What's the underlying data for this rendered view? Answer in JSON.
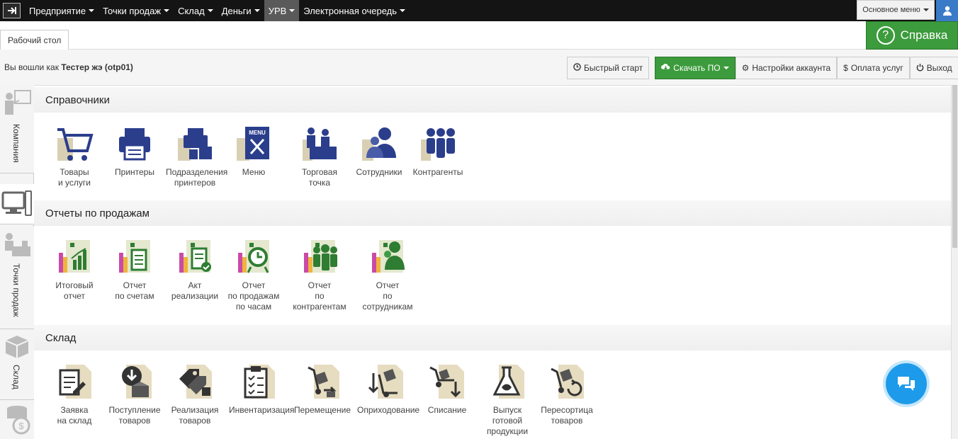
{
  "topbar": {
    "items": [
      {
        "label": "Предприятие"
      },
      {
        "label": "Точки продаж"
      },
      {
        "label": "Склад"
      },
      {
        "label": "Деньги"
      },
      {
        "label": "УРВ"
      },
      {
        "label": "Электронная очередь"
      }
    ],
    "active_item": "УРВ",
    "main_menu_label": "Основное меню"
  },
  "tabs": [
    {
      "label": "Рабочий стол"
    }
  ],
  "help_label": "Справка",
  "login": {
    "prefix": "Вы вошли как",
    "user": "Тестер жэ (otp01)"
  },
  "toolbar": {
    "quick_start": "Быстрый старт",
    "download": "Скачать ПО",
    "account_settings": "Настройки аккаунта",
    "payment": "Оплата услуг",
    "logout": "Выход"
  },
  "sidebar": {
    "items": [
      {
        "label": "Компания"
      },
      {
        "label": "Точки продаж"
      },
      {
        "label": "Склад"
      }
    ]
  },
  "sections": [
    {
      "title": "Справочники",
      "tiles": [
        {
          "label": "Товары\nи услуги",
          "icon": "cart-icon"
        },
        {
          "label": "Принтеры",
          "icon": "printer-icon"
        },
        {
          "label": "Подразделения\nпринтеров",
          "icon": "printer-department-icon"
        },
        {
          "label": "Меню",
          "icon": "menu-icon"
        },
        {
          "label": "Торговая\nточка",
          "icon": "store-icon"
        },
        {
          "label": "Сотрудники",
          "icon": "employees-icon"
        },
        {
          "label": "Контрагенты",
          "icon": "contractors-icon"
        }
      ]
    },
    {
      "title": "Отчеты по продажам",
      "tiles": [
        {
          "label": "Итоговый\nотчет",
          "icon": "summary-report-icon"
        },
        {
          "label": "Отчет\nпо счетам",
          "icon": "bills-report-icon"
        },
        {
          "label": "Акт\nреализации",
          "icon": "sales-act-icon"
        },
        {
          "label": "Отчет\nпо продажам\nпо часам",
          "icon": "hourly-report-icon"
        },
        {
          "label": "Отчет\nпо контрагентам",
          "icon": "contractors-report-icon"
        },
        {
          "label": "Отчет\nпо сотрудникам",
          "icon": "employees-report-icon"
        }
      ]
    },
    {
      "title": "Склад",
      "tiles": [
        {
          "label": "Заявка\nна склад",
          "icon": "warehouse-request-icon"
        },
        {
          "label": "Поступление\nтоваров",
          "icon": "goods-receipt-icon"
        },
        {
          "label": "Реализация\nтоваров",
          "icon": "goods-sale-icon"
        },
        {
          "label": "Инвентаризация",
          "icon": "inventory-icon"
        },
        {
          "label": "Перемещение",
          "icon": "transfer-icon"
        },
        {
          "label": "Оприходование",
          "icon": "posting-icon"
        },
        {
          "label": "Списание",
          "icon": "write-off-icon"
        },
        {
          "label": "Выпуск\nготовой\nпродукции",
          "icon": "production-icon"
        },
        {
          "label": "Пересортица\nтоваров",
          "icon": "regrading-icon"
        }
      ]
    }
  ],
  "colors": {
    "accent_green": "#3c9b3c",
    "icon_navy": "#2b3e8c",
    "report_green": "#2e7d32",
    "chat_blue": "#1d9bea"
  }
}
